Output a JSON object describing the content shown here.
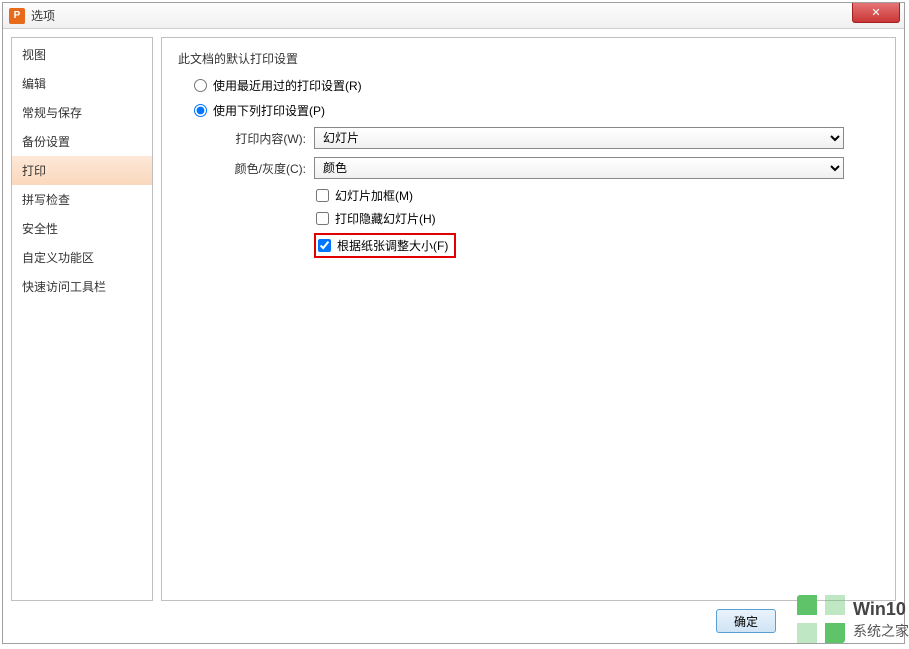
{
  "titlebar": {
    "icon": "P",
    "title": "选项",
    "close": "✕"
  },
  "sidebar": {
    "items": [
      {
        "label": "视图"
      },
      {
        "label": "编辑"
      },
      {
        "label": "常规与保存"
      },
      {
        "label": "备份设置"
      },
      {
        "label": "打印",
        "active": true
      },
      {
        "label": "拼写检查"
      },
      {
        "label": "安全性"
      },
      {
        "label": "自定义功能区"
      },
      {
        "label": "快速访问工具栏"
      }
    ]
  },
  "groupbox": {
    "title": "此文档的默认打印设置"
  },
  "radios": {
    "recent": "使用最近用过的打印设置(R)",
    "following": "使用下列打印设置(P)"
  },
  "form": {
    "printContentLabel": "打印内容(W):",
    "printContentValue": "幻灯片",
    "colorLabel": "颜色/灰度(C):",
    "colorValue": "颜色"
  },
  "checks": {
    "frame": "幻灯片加框(M)",
    "hidden": "打印隐藏幻灯片(H)",
    "scale": "根据纸张调整大小(F)"
  },
  "footer": {
    "ok": "确定"
  },
  "watermark": {
    "line1": "Win10",
    "line2": "系统之家"
  }
}
